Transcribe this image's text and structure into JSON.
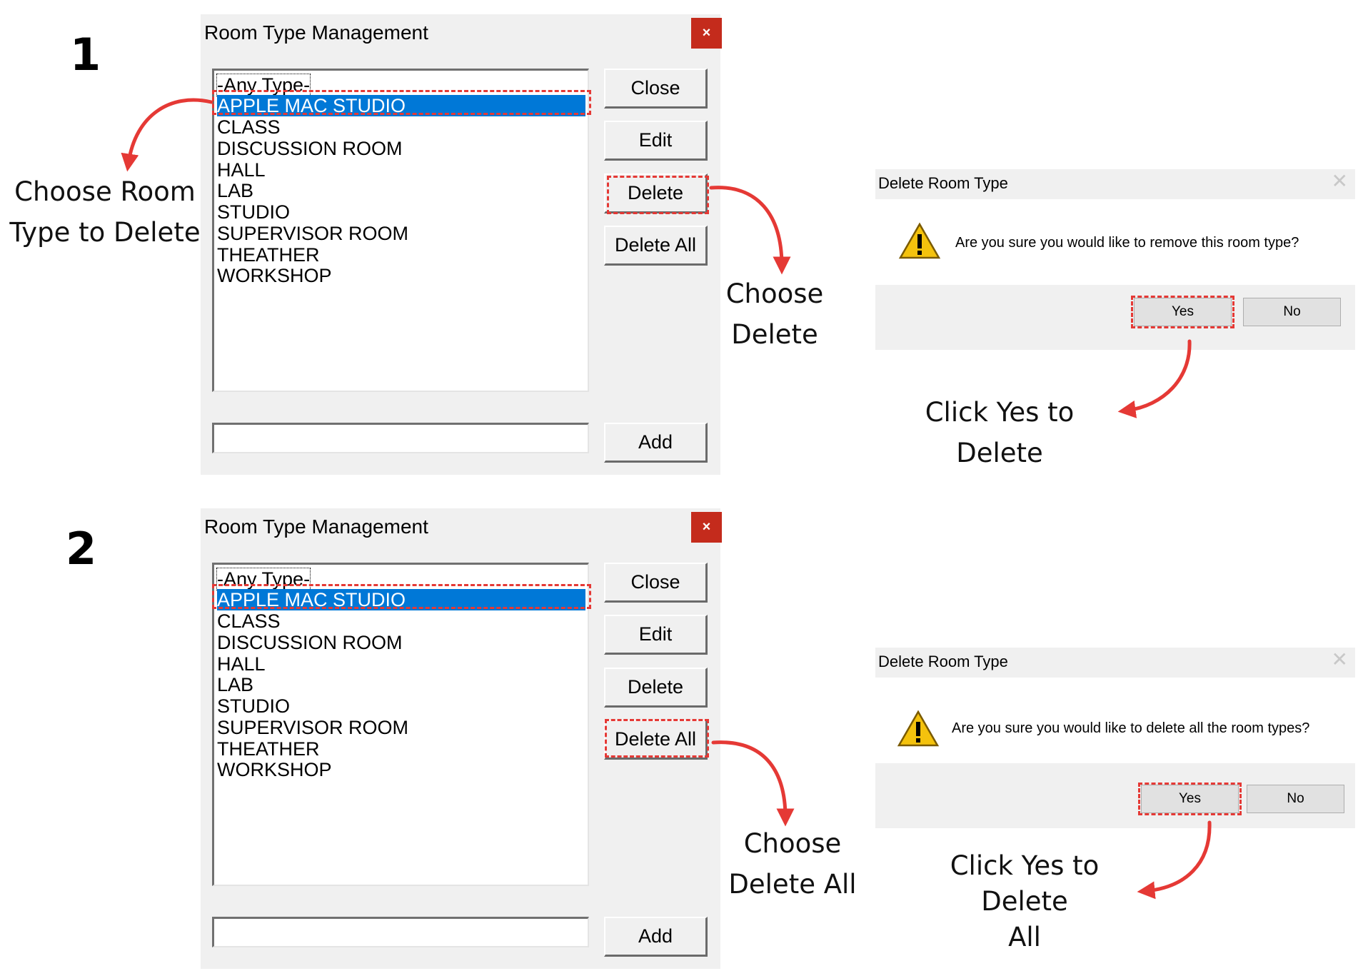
{
  "steps": [
    {
      "number": "1",
      "window": {
        "title": "Room Type Management",
        "close_icon": "×",
        "list_items": [
          "-Any Type-",
          "APPLE MAC STUDIO",
          "CLASS",
          "DISCUSSION ROOM",
          "HALL",
          "LAB",
          "STUDIO",
          "SUPERVISOR ROOM",
          "THEATHER",
          "WORKSHOP"
        ],
        "selected_index": 1,
        "buttons": [
          "Close",
          "Edit",
          "Delete",
          "Delete All"
        ],
        "add_button": "Add",
        "input_value": ""
      },
      "dialog": {
        "title": "Delete Room Type",
        "close_icon": "✕",
        "message": "Are you sure you would like to remove this room type?",
        "yes_label": "Yes",
        "no_label": "No"
      },
      "annotations": {
        "select_hint": [
          "Choose Room",
          "Type to Delete"
        ],
        "button_hint": [
          "Choose",
          "Delete"
        ],
        "dialog_hint": [
          "Click Yes to Delete"
        ]
      }
    },
    {
      "number": "2",
      "window": {
        "title": "Room Type Management",
        "close_icon": "×",
        "list_items": [
          "-Any Type-",
          "APPLE MAC STUDIO",
          "CLASS",
          "DISCUSSION ROOM",
          "HALL",
          "LAB",
          "STUDIO",
          "SUPERVISOR ROOM",
          "THEATHER",
          "WORKSHOP"
        ],
        "selected_index": 1,
        "buttons": [
          "Close",
          "Edit",
          "Delete",
          "Delete All"
        ],
        "add_button": "Add",
        "input_value": ""
      },
      "dialog": {
        "title": "Delete Room Type",
        "close_icon": "✕",
        "message": "Are you sure you would like to delete all the room types?",
        "yes_label": "Yes",
        "no_label": "No"
      },
      "annotations": {
        "button_hint": [
          "Choose",
          "Delete All"
        ],
        "dialog_hint": [
          "Click Yes to Delete",
          "All"
        ]
      }
    }
  ],
  "colors": {
    "annotation_red": "#e53935",
    "selection_blue": "#0078d7",
    "close_red": "#c42b1c"
  }
}
